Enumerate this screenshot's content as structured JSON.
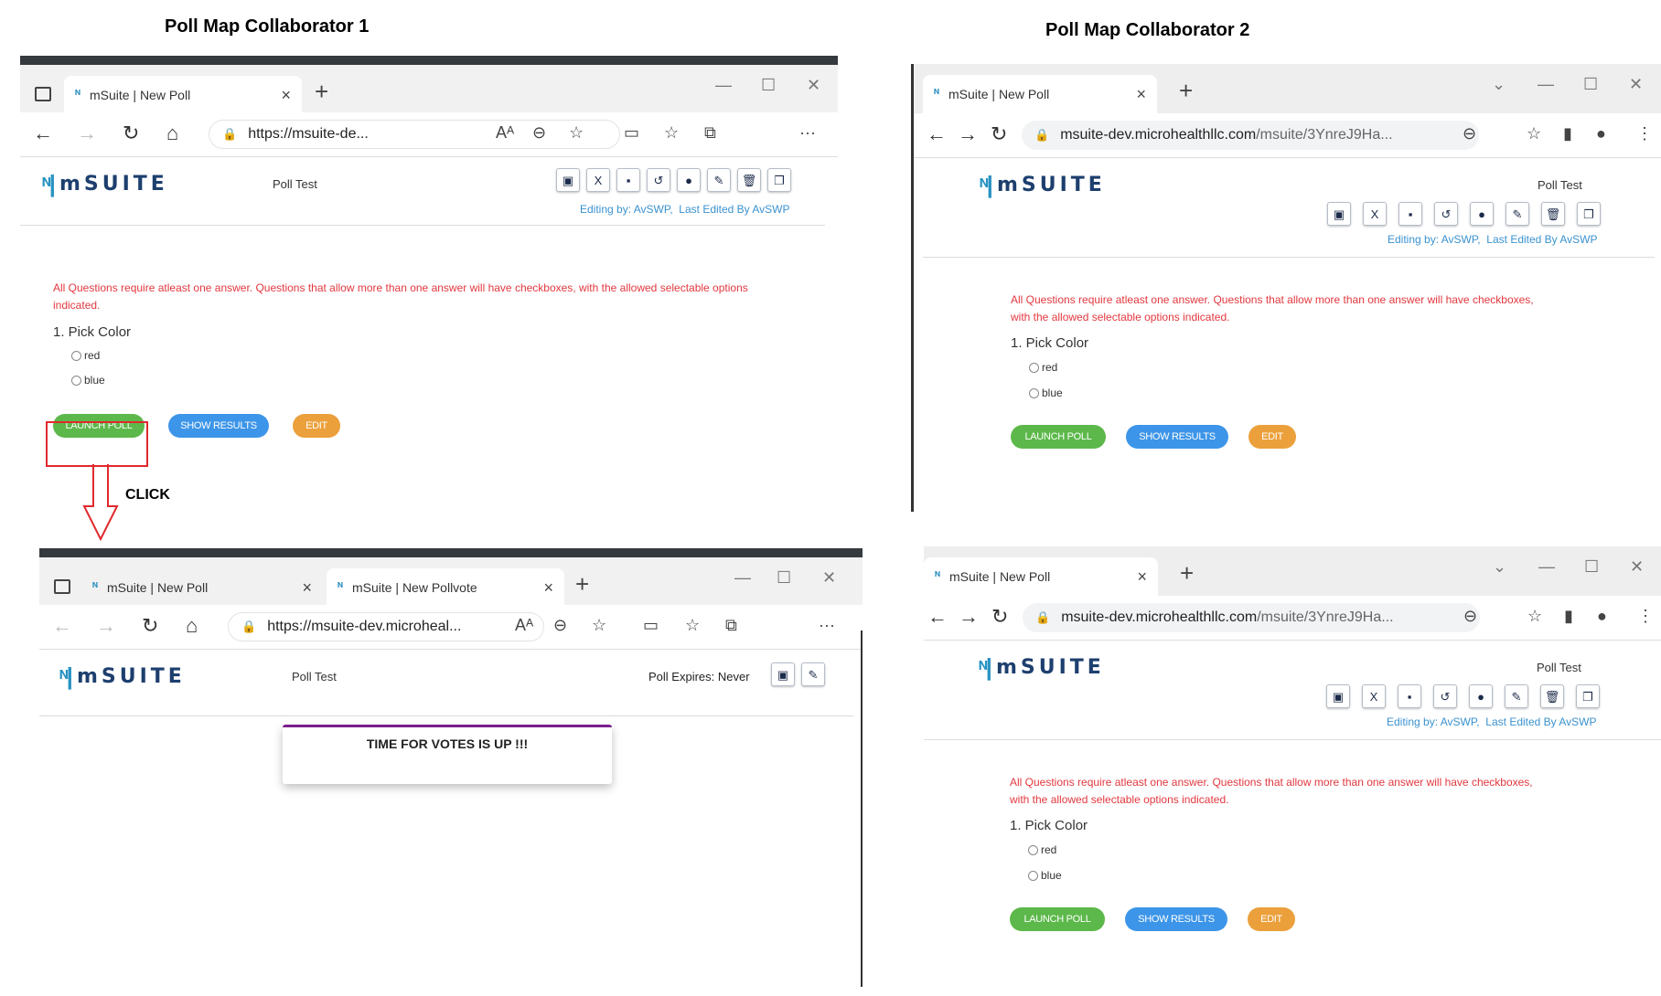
{
  "labels": {
    "collab1": "Poll Map Collaborator 1",
    "collab2": "Poll Map Collaborator 2",
    "click": "CLICK"
  },
  "browser": {
    "tab_new_poll": "mSuite | New Poll",
    "tab_new_pollvote": "mSuite | New Pollvote",
    "edge_url_1": "https://msuite-de...",
    "edge_url_2": "https://msuite-dev.microheal...",
    "chrome_url_host": "msuite-dev.microhealthllc.com",
    "chrome_url_path": "/msuite/3YnreJ9Ha..."
  },
  "app": {
    "logo_text": "mSUITE",
    "poll_title": "Poll Test",
    "editing_by": "Editing by: AvSWP,",
    "last_edited": "Last Edited By AvSWP",
    "instructions": "All Questions require atleast one answer. Questions that allow more than one answer will have checkboxes, with the allowed selectable options indicated.",
    "question": "1. Pick Color",
    "options": [
      "red",
      "blue"
    ],
    "buttons": {
      "launch": "LAUNCH POLL",
      "results": "SHOW RESULTS",
      "edit": "EDIT"
    },
    "expires": "Poll Expires: Never",
    "modal_message": "TIME FOR VOTES IS UP !!!"
  },
  "toolbar_icons": [
    "image-icon",
    "excel-icon",
    "save-icon",
    "refresh-icon",
    "chat-icon",
    "user-edit-icon",
    "trash-icon",
    "copy-icon"
  ],
  "colors": {
    "green": "#5cb84a",
    "blue": "#3c95e8",
    "orange": "#eba03b",
    "instruction_red": "#e2383f",
    "editing_blue": "#3a92cf",
    "logo_navy": "#1d3f6e",
    "highlight_red": "#e0292d",
    "modal_accent": "#7a1e8f"
  }
}
